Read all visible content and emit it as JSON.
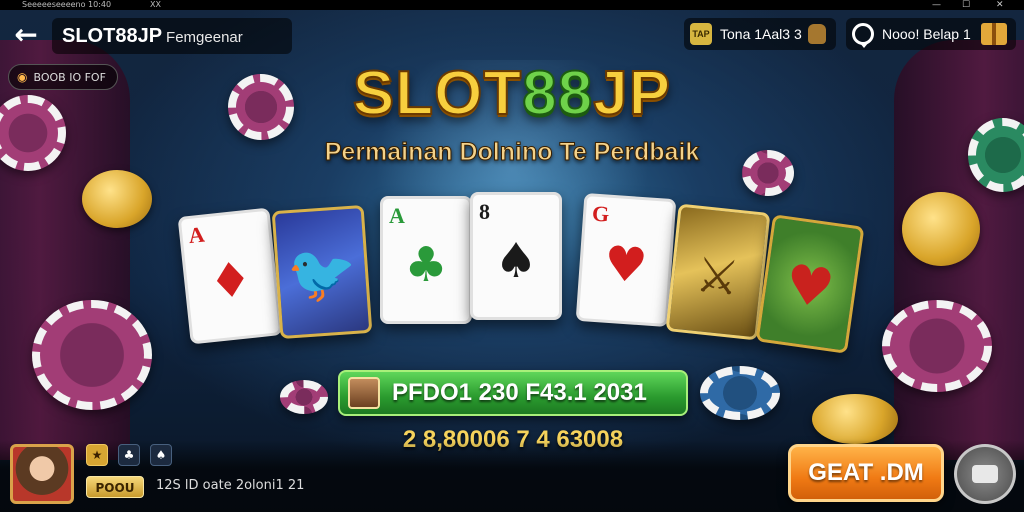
{
  "window": {
    "title": "Seeeeeseeeeno 10:40",
    "menu_glyph": "ⅩⅩ",
    "controls": [
      "—",
      "☐",
      "✕"
    ]
  },
  "header": {
    "back_label": "←",
    "brand": "SLOT88JP",
    "subtitle": "Femgeenar",
    "balance_badge": "TAP",
    "balance_text": "Tona 1Aal3 3",
    "support_text": "Nooo! Belap 1"
  },
  "status": {
    "text": "BOOB IO FOF"
  },
  "hero": {
    "logo_prefix": "SLOT",
    "logo_number": "88",
    "logo_suffix": "JP",
    "tagline": "Permainan Dolnino Te Perdbaik"
  },
  "cards": [
    {
      "rank": "A",
      "suit": "♦",
      "style": "plain",
      "color": "red"
    },
    {
      "rank": "",
      "suit": "🐦",
      "style": "art",
      "color": "grn"
    },
    {
      "rank": "A",
      "suit": "♣",
      "style": "plain",
      "color": "grn"
    },
    {
      "rank": "8",
      "suit": "♠",
      "style": "plain",
      "color": "blk"
    },
    {
      "rank": "G",
      "suit": "♥",
      "style": "plain",
      "color": "red"
    },
    {
      "rank": "",
      "suit": "⚔",
      "style": "gold",
      "color": "blk"
    },
    {
      "rank": "",
      "suit": "♥",
      "style": "green",
      "color": "red"
    }
  ],
  "prize": {
    "text": "PFDO1  230 F43.1 2031"
  },
  "jackpot": {
    "text": "2 8,80006 7 4 63008"
  },
  "bottom": {
    "level_label": "POOU",
    "stat_text": "12S  lD oate 2oloni1 21",
    "play_label": "GEAT .DM",
    "icons": [
      "★",
      "♣",
      "♠"
    ]
  }
}
